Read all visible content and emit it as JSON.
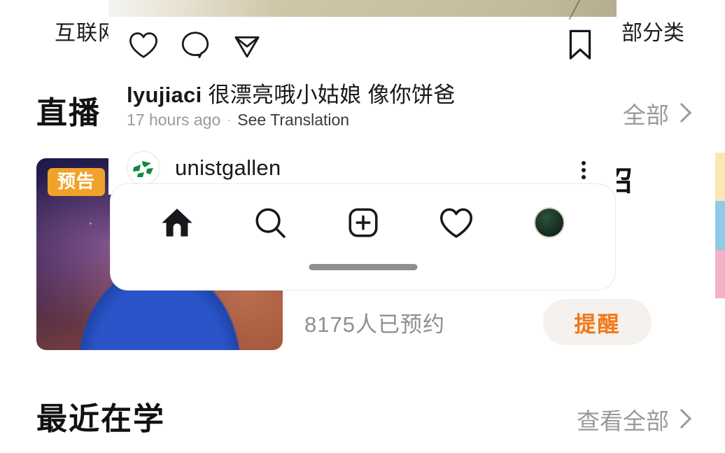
{
  "background_app": {
    "nav": {
      "title_left": "互联网",
      "title_right": "部分类"
    },
    "sections": [
      {
        "id": "live",
        "title": "直播",
        "more_label": "全部"
      },
      {
        "id": "recent",
        "title": "最近在学",
        "more_label": "查看全部"
      }
    ],
    "live_card": {
      "badge": "预告",
      "reserved_text": "8175人已预约",
      "remind_button": "提醒"
    },
    "peek_char": "召",
    "edge_strip_colors": [
      "#fae7b4",
      "#8fcbe8",
      "#f0b3c8"
    ]
  },
  "instagram_overlay": {
    "actions": {
      "like": "heart-icon",
      "comment": "comment-icon",
      "share": "share-icon",
      "save": "bookmark-icon"
    },
    "caption": {
      "username": "lyujiaci",
      "text": "很漂亮哦小姑娘 像你饼爸"
    },
    "meta": {
      "time": "17 hours ago",
      "separator": "·",
      "translate_label": "See Translation"
    },
    "next_post": {
      "username": "unistgallen",
      "more_icon": "more-vertical-icon"
    },
    "tabbar": [
      {
        "name": "home",
        "icon": "home-icon"
      },
      {
        "name": "search",
        "icon": "search-icon"
      },
      {
        "name": "create",
        "icon": "plus-square-icon"
      },
      {
        "name": "activity",
        "icon": "heart-icon"
      },
      {
        "name": "profile",
        "icon": "profile-avatar"
      }
    ]
  },
  "colors": {
    "accent_orange": "#f07818",
    "badge_orange": "#f0a22b",
    "muted_text": "#8e8e93",
    "primary_text": "#16181c"
  }
}
